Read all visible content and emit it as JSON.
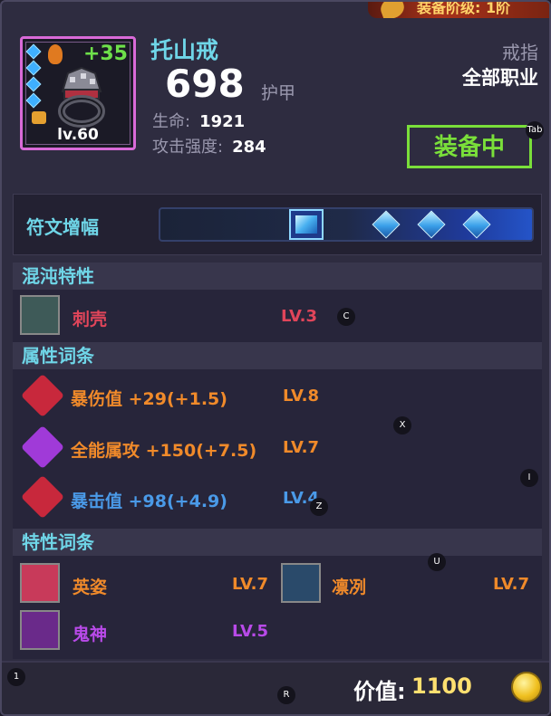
{
  "banner": {
    "tier_text": "装备阶级: 1阶"
  },
  "item": {
    "name": "托山戒",
    "enhance": "+35",
    "level": "lv.60",
    "armor_value": "698",
    "armor_label": "护甲",
    "hp_label": "生命:",
    "hp_value": "1921",
    "atk_label": "攻击强度:",
    "atk_value": "284",
    "slot_type": "戒指",
    "class_req": "全部职业",
    "equipped_label": "装备中",
    "icon": "ring-icon"
  },
  "rune": {
    "label": "符文增幅"
  },
  "chaos": {
    "header": "混沌特性",
    "traits": [
      {
        "name": "刺壳",
        "level": "LV.3",
        "color": "#e0455a",
        "icon": "thorn-shell-icon"
      }
    ]
  },
  "attributes": {
    "header": "属性词条",
    "items": [
      {
        "name": "暴伤值",
        "bonus": "+29(+1.5)",
        "level": "LV.8",
        "color": "#f08a2a",
        "icon_color": "#c8283c",
        "icon": "crit-damage-icon"
      },
      {
        "name": "全能属攻",
        "bonus": "+150(+7.5)",
        "level": "LV.7",
        "color": "#f08a2a",
        "icon_color": "#a03ad8",
        "icon": "all-element-attack-icon"
      },
      {
        "name": "暴击值",
        "bonus": "+98(+4.9)",
        "level": "LV.4",
        "color": "#4a9ae8",
        "icon_color": "#c8283c",
        "icon": "crit-rate-icon"
      }
    ]
  },
  "traits": {
    "header": "特性词条",
    "items": [
      {
        "name": "英姿",
        "level": "LV.7",
        "color": "#f08a2a",
        "icon": "heart-face-icon"
      },
      {
        "name": "凛冽",
        "level": "LV.7",
        "color": "#f08a2a",
        "icon": "frost-icon"
      },
      {
        "name": "鬼神",
        "level": "LV.5",
        "color": "#b84ae8",
        "icon": "ghost-deity-icon"
      }
    ]
  },
  "footer": {
    "value_label": "价值:",
    "value_num": "1100"
  },
  "keys": {
    "tab": "Tab",
    "c": "C",
    "x": "X",
    "i": "I",
    "z": "Z",
    "u": "U",
    "one": "1",
    "r": "R"
  },
  "colors": {
    "accent_cyan": "#6fd6e8",
    "equipped_green": "#7adf3a",
    "item_frame": "#d96ad8"
  }
}
